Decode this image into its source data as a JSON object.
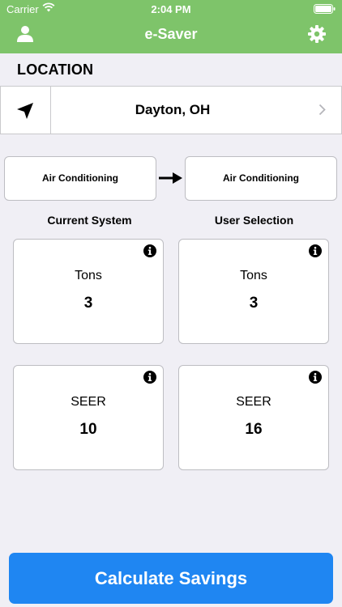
{
  "status_bar": {
    "carrier": "Carrier",
    "time": "2:04 PM"
  },
  "nav": {
    "title": "e-Saver",
    "left_icon": "user-icon",
    "right_icon": "gear-icon"
  },
  "location": {
    "section_title": "LOCATION",
    "city": "Dayton, OH",
    "icon": "location-arrow-icon"
  },
  "systems": {
    "from_label": "Air Conditioning",
    "to_label": "Air Conditioning"
  },
  "columns": {
    "current": "Current System",
    "selection": "User Selection"
  },
  "cards": {
    "current_tons": {
      "label": "Tons",
      "value": "3"
    },
    "selected_tons": {
      "label": "Tons",
      "value": "3"
    },
    "current_seer": {
      "label": "SEER",
      "value": "10"
    },
    "selected_seer": {
      "label": "SEER",
      "value": "16"
    }
  },
  "action": {
    "calculate_label": "Calculate Savings"
  },
  "colors": {
    "nav_green": "#7ec46a",
    "button_blue": "#1f86f2",
    "background": "#f0eff5"
  }
}
